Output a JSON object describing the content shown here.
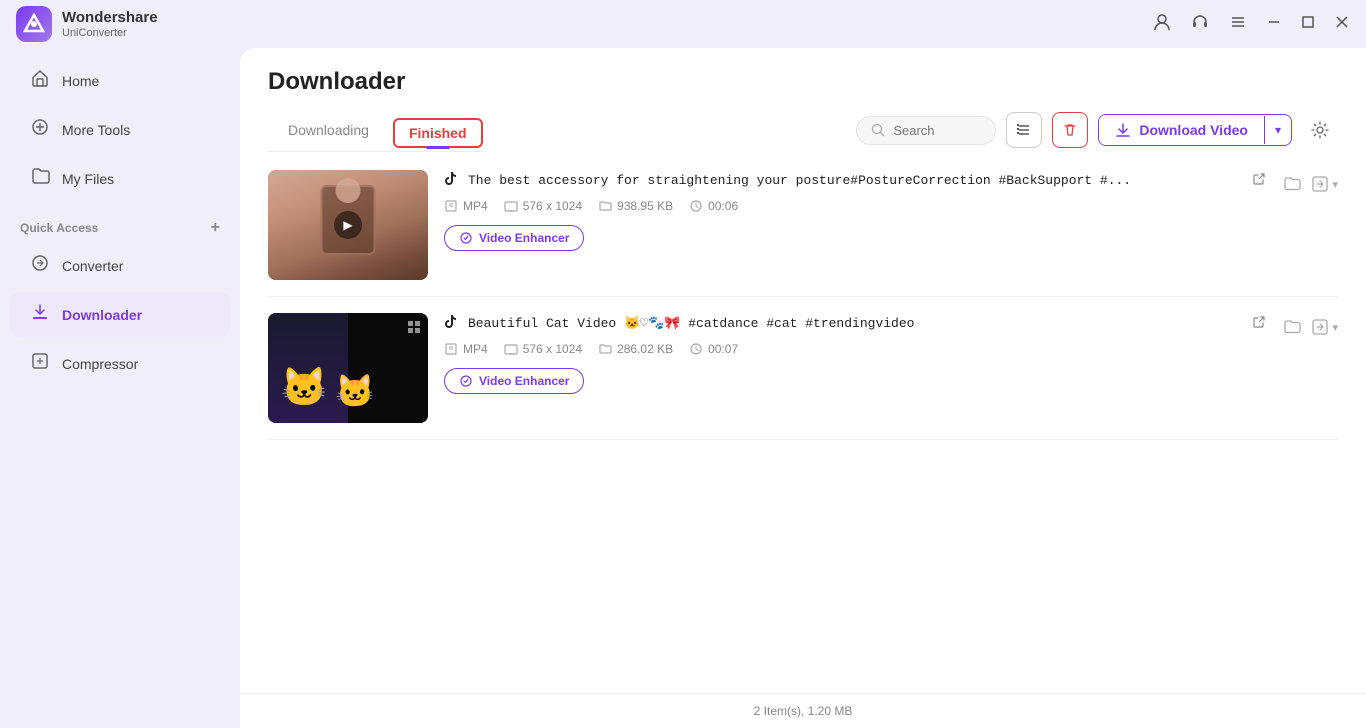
{
  "app": {
    "name": "Wondershare",
    "sub_name": "UniConverter",
    "logo_letter": "W"
  },
  "titlebar": {
    "icons": [
      "user-icon",
      "headset-icon",
      "list-icon",
      "minimize-icon",
      "maximize-icon",
      "close-icon"
    ]
  },
  "sidebar": {
    "items": [
      {
        "id": "home",
        "label": "Home",
        "icon": "🏠"
      },
      {
        "id": "more-tools",
        "label": "More Tools",
        "icon": "🔧"
      },
      {
        "id": "my-files",
        "label": "My Files",
        "icon": "📁"
      }
    ],
    "quick_access_label": "Quick Access",
    "quick_access_plus": "+",
    "bottom_items": [
      {
        "id": "converter",
        "label": "Converter",
        "icon": "🔄"
      },
      {
        "id": "downloader",
        "label": "Downloader",
        "icon": "⬇",
        "active": true
      },
      {
        "id": "compressor",
        "label": "Compressor",
        "icon": "🗜"
      }
    ]
  },
  "main": {
    "page_title": "Downloader",
    "tabs": [
      {
        "id": "downloading",
        "label": "Downloading",
        "active": false
      },
      {
        "id": "finished",
        "label": "Finished",
        "active": true
      }
    ],
    "toolbar": {
      "search_placeholder": "Search",
      "download_video_label": "Download Video"
    },
    "videos": [
      {
        "id": "video1",
        "platform": "tiktok",
        "title": "The best accessory for straightening your posture#PostureCorrection #BackSupport #...",
        "format": "MP4",
        "resolution": "576 x 1024",
        "size": "938.95 KB",
        "duration": "00:06",
        "enhancer_label": "Video Enhancer"
      },
      {
        "id": "video2",
        "platform": "tiktok",
        "title": "Beautiful Cat Video 🐱♡🐾🎀 #catdance  #cat  #trendingvideo",
        "format": "MP4",
        "resolution": "576 x 1024",
        "size": "286.02 KB",
        "duration": "00:07",
        "enhancer_label": "Video Enhancer"
      }
    ],
    "status_bar": "2 Item(s), 1.20 MB"
  }
}
